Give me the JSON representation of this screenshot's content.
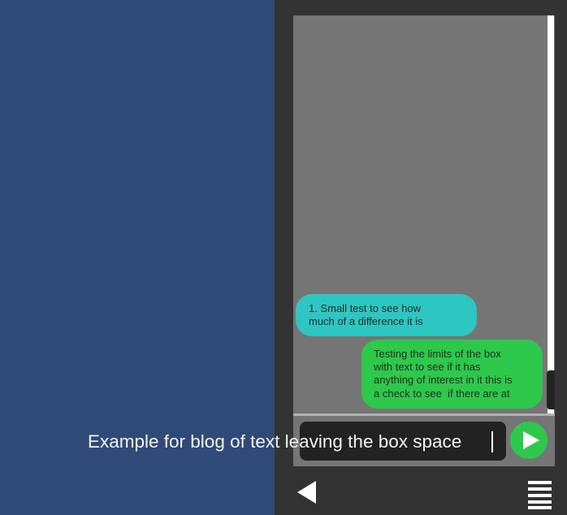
{
  "chat": {
    "messages": [
      {
        "sender": "other",
        "text": "1. Small test to see how\nmuch of a difference it is"
      },
      {
        "sender": "self",
        "text": "Testing the limits of the box\nwith text to see if it has\nanything of interest in it this is\na check to see  if there are at"
      }
    ]
  },
  "composer": {
    "input_value": "Example for blog of text leaving the box space"
  },
  "icons": {
    "send": "play-triangle-icon",
    "back": "back-triangle-icon",
    "menu": "hamburger-menu-icon"
  },
  "colors": {
    "background": "#2f4a76",
    "panel": "#333333",
    "chat_bg": "#757575",
    "received_bubble": "#2ec6c2",
    "sent_bubble": "#2ec84b",
    "input_bg": "#222222"
  }
}
